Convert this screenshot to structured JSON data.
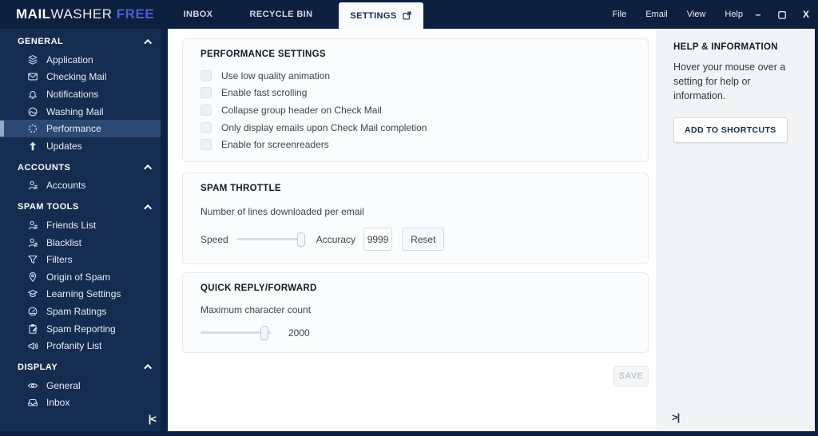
{
  "topbar": {
    "logo": {
      "part1": "MAIL",
      "part2": "WASHER",
      "part3": "FREE"
    },
    "tabs": [
      {
        "label": "INBOX",
        "active": false
      },
      {
        "label": "RECYCLE BIN",
        "active": false
      },
      {
        "label": "SETTINGS",
        "active": true,
        "icon": "external-link-icon"
      }
    ],
    "menu": [
      "File",
      "Email",
      "View",
      "Help"
    ],
    "window_controls": {
      "minimize": "–",
      "maximize": "▢",
      "close": "X"
    }
  },
  "sidebar": {
    "sections": [
      {
        "title": "GENERAL",
        "items": [
          {
            "label": "Application",
            "icon": "layers-icon"
          },
          {
            "label": "Checking Mail",
            "icon": "mail-icon"
          },
          {
            "label": "Notifications",
            "icon": "bell-icon"
          },
          {
            "label": "Washing Mail",
            "icon": "wash-icon"
          },
          {
            "label": "Performance",
            "icon": "spinner-icon",
            "selected": true
          },
          {
            "label": "Updates",
            "icon": "arrow-up-icon"
          }
        ]
      },
      {
        "title": "ACCOUNTS",
        "items": [
          {
            "label": "Accounts",
            "icon": "user-icon"
          }
        ]
      },
      {
        "title": "SPAM TOOLS",
        "items": [
          {
            "label": "Friends List",
            "icon": "user-icon"
          },
          {
            "label": "Blacklist",
            "icon": "user-icon"
          },
          {
            "label": "Filters",
            "icon": "funnel-icon"
          },
          {
            "label": "Origin of Spam",
            "icon": "pin-icon"
          },
          {
            "label": "Learning Settings",
            "icon": "grad-cap-icon"
          },
          {
            "label": "Spam Ratings",
            "icon": "gauge-icon"
          },
          {
            "label": "Spam Reporting",
            "icon": "clipboard-icon"
          },
          {
            "label": "Profanity List",
            "icon": "megaphone-icon"
          }
        ]
      },
      {
        "title": "DISPLAY",
        "items": [
          {
            "label": "General",
            "icon": "eye-icon"
          },
          {
            "label": "Inbox",
            "icon": "inbox-icon"
          }
        ]
      }
    ],
    "collapse_icon": "|<"
  },
  "main": {
    "performance": {
      "title": "PERFORMANCE SETTINGS",
      "checkboxes": [
        {
          "label": "Use low quality animation",
          "checked": false
        },
        {
          "label": "Enable fast scrolling",
          "checked": false
        },
        {
          "label": "Collapse group header on Check Mail",
          "checked": false
        },
        {
          "label": "Only display emails upon Check Mail completion",
          "checked": false
        },
        {
          "label": "Enable for screenreaders",
          "checked": false
        }
      ]
    },
    "spam_throttle": {
      "title": "SPAM THROTTLE",
      "description": "Number of lines downloaded per email",
      "speed_label": "Speed",
      "speed_slider_percent": 100,
      "accuracy_label": "Accuracy",
      "accuracy_value": "9999",
      "reset_label": "Reset"
    },
    "quick_reply": {
      "title": "QUICK REPLY/FORWARD",
      "description": "Maximum character count",
      "slider_percent": 92,
      "value": "2000"
    },
    "save_label": "SAVE"
  },
  "help_panel": {
    "title": "HELP & INFORMATION",
    "body": "Hover your mouse over a setting for help or information.",
    "button_label": "ADD TO SHORTCUTS",
    "expand_icon": ">|"
  },
  "colors": {
    "titlebar": "#0c1f3e",
    "sidebar": "#142c50",
    "accent_free": "#4d5fd3",
    "logo_icon": "#5fb0d8",
    "selected_item": "#2b4973"
  }
}
